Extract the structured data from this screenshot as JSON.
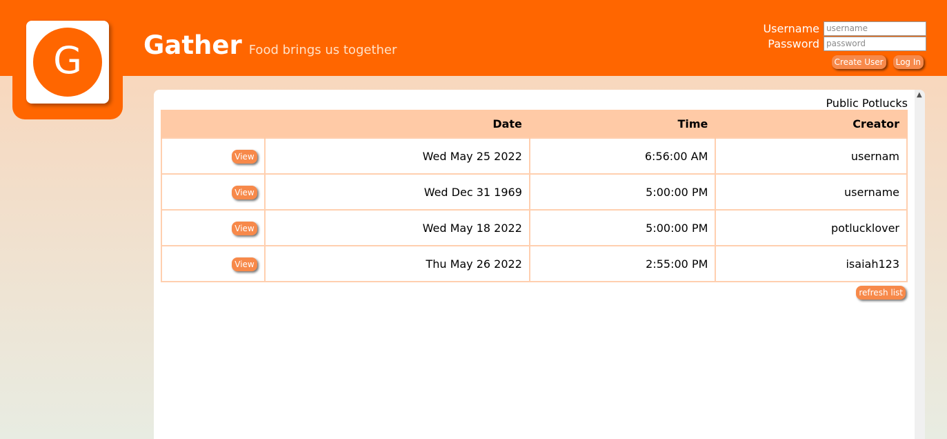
{
  "colors": {
    "brand_orange": "#ff6600",
    "button_orange": "#f7894a",
    "table_header": "#ffcaa6",
    "table_border": "#ffcfaf",
    "tagline": "#ffe2c8"
  },
  "header": {
    "logo_letter": "G",
    "title": "Gather",
    "tagline": "Food brings us together"
  },
  "login": {
    "username_label": "Username",
    "username_placeholder": "username",
    "password_label": "Password",
    "password_placeholder": "password",
    "create_user_label": "Create User",
    "log_in_label": "Log In"
  },
  "potlucks": {
    "title": "Public Potlucks",
    "columns": [
      "",
      "Date",
      "Time",
      "Creator"
    ],
    "rows": [
      {
        "view_label": "View",
        "date": "Wed May 25 2022",
        "time": "6:56:00 AM",
        "creator": "usernam"
      },
      {
        "view_label": "View",
        "date": "Wed Dec 31 1969",
        "time": "5:00:00 PM",
        "creator": "username"
      },
      {
        "view_label": "View",
        "date": "Wed May 18 2022",
        "time": "5:00:00 PM",
        "creator": "potlucklover"
      },
      {
        "view_label": "View",
        "date": "Thu May 26 2022",
        "time": "2:55:00 PM",
        "creator": "isaiah123"
      }
    ],
    "refresh_label": "refresh list"
  },
  "scrollbar": {
    "up_icon": "chevron-up-icon"
  }
}
